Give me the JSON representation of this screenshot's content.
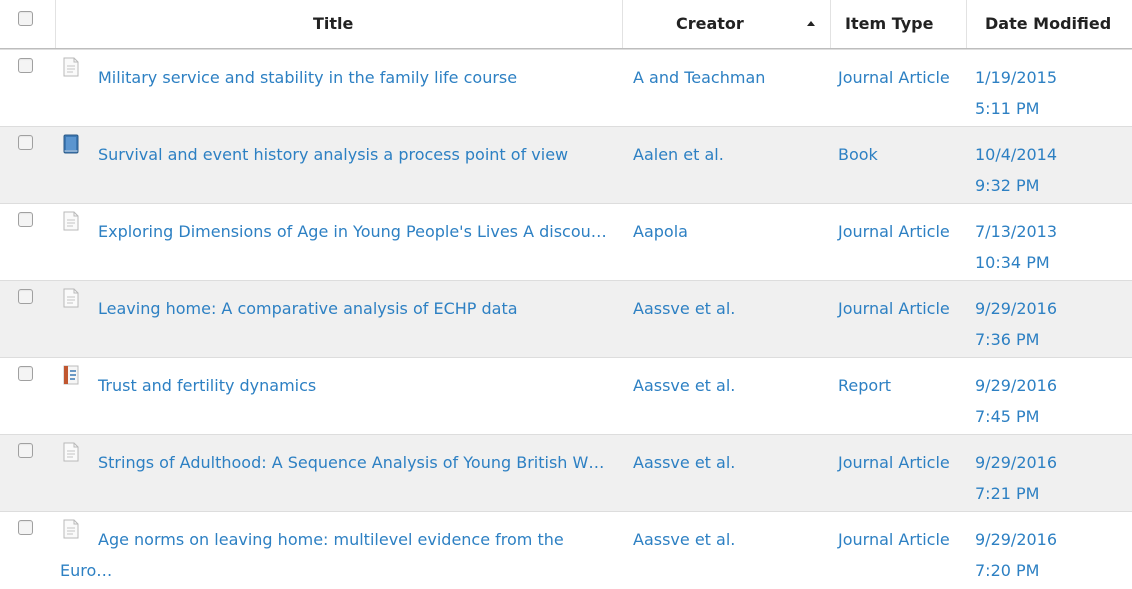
{
  "header": {
    "title": "Title",
    "creator": "Creator",
    "item_type": "Item Type",
    "date_modified": "Date Modified"
  },
  "items": [
    {
      "icon": "document-icon",
      "title": "Military service and stability in the family life course",
      "creator": "A and Teachman",
      "item_type": "Journal Article",
      "date": "1/19/2015",
      "time": "5:11 PM"
    },
    {
      "icon": "book-icon",
      "title": "Survival and event history analysis a process point of view",
      "creator": "Aalen et al.",
      "item_type": "Book",
      "date": "10/4/2014",
      "time": "9:32 PM"
    },
    {
      "icon": "document-icon",
      "title": "Exploring Dimensions of Age in Young People's Lives A discou…",
      "creator": "Aapola",
      "item_type": "Journal Article",
      "date": "7/13/2013",
      "time": "10:34 PM"
    },
    {
      "icon": "document-icon",
      "title": "Leaving home: A comparative analysis of ECHP data",
      "creator": "Aassve et al.",
      "item_type": "Journal Article",
      "date": "9/29/2016",
      "time": "7:36 PM"
    },
    {
      "icon": "report-icon",
      "title": "Trust and fertility dynamics",
      "creator": "Aassve et al.",
      "item_type": "Report",
      "date": "9/29/2016",
      "time": "7:45 PM"
    },
    {
      "icon": "document-icon",
      "title": "Strings of Adulthood: A Sequence Analysis of Young British W…",
      "creator": "Aassve et al.",
      "item_type": "Journal Article",
      "date": "9/29/2016",
      "time": "7:21 PM"
    },
    {
      "icon": "document-icon",
      "title": "Age norms on leaving home: multilevel evidence from the Euro…",
      "creator": "Aassve et al.",
      "item_type": "Journal Article",
      "date": "9/29/2016",
      "time": "7:20 PM"
    }
  ],
  "colors": {
    "link": "#2d80c3",
    "alt_row": "#f0f0f0",
    "header_text": "#222222"
  }
}
